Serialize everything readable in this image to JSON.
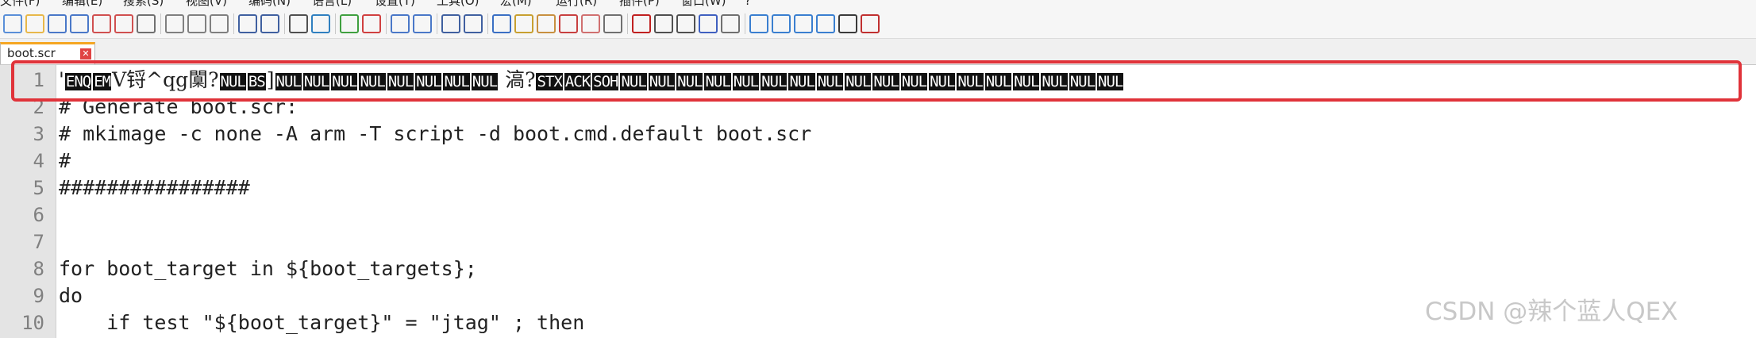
{
  "menu": [
    "文件(F)",
    "编辑(E)",
    "搜索(S)",
    "视图(V)",
    "编码(N)",
    "语言(L)",
    "设置(T)",
    "工具(O)",
    "宏(M)",
    "运行(R)",
    "插件(P)",
    "窗口(W)",
    "?"
  ],
  "toolbar_icons": [
    "new-file-icon",
    "open-file-icon",
    "save-icon",
    "save-all-icon",
    "close-icon",
    "close-all-icon",
    "print-icon",
    "cut-icon",
    "copy-icon",
    "paste-icon",
    "undo-icon",
    "redo-icon",
    "find-icon",
    "replace-icon",
    "zoom-in-icon",
    "zoom-out-icon",
    "sync-vertical-icon",
    "sync-horizontal-icon",
    "word-wrap-icon",
    "show-all-chars-icon",
    "indent-guide-icon",
    "udl-icon",
    "doc-map-icon",
    "function-list-icon",
    "folder-workspace-icon",
    "monitor-icon",
    "record-macro-icon",
    "stop-record-icon",
    "play-macro-icon",
    "run-macro-multiple-icon",
    "save-macro-icon",
    "spell-check-first-icon",
    "spell-check-prev-icon",
    "spell-check-next-icon",
    "spell-check-all-icon",
    "spell-check-icon",
    "abc-spell-icon"
  ],
  "tab": {
    "label": "boot.scr",
    "close": "✕"
  },
  "line1_segments": [
    {
      "t": "'",
      "ctl": false
    },
    {
      "t": "ENQ",
      "ctl": true
    },
    {
      "t": "EM",
      "ctl": true
    },
    {
      "t": "V锊^qg闑?",
      "ctl": false
    },
    {
      "t": "NUL",
      "ctl": true
    },
    {
      "t": "BS",
      "ctl": true
    },
    {
      "t": "]",
      "ctl": false
    },
    {
      "t": "NUL",
      "ctl": true
    },
    {
      "t": "NUL",
      "ctl": true
    },
    {
      "t": "NUL",
      "ctl": true
    },
    {
      "t": "NUL",
      "ctl": true
    },
    {
      "t": "NUL",
      "ctl": true
    },
    {
      "t": "NUL",
      "ctl": true
    },
    {
      "t": "NUL",
      "ctl": true
    },
    {
      "t": "NUL",
      "ctl": true
    },
    {
      "t": " 滈?",
      "ctl": false
    },
    {
      "t": "STX",
      "ctl": true
    },
    {
      "t": "ACK",
      "ctl": true
    },
    {
      "t": "SOH",
      "ctl": true
    },
    {
      "t": "NUL",
      "ctl": true
    },
    {
      "t": "NUL",
      "ctl": true
    },
    {
      "t": "NUL",
      "ctl": true
    },
    {
      "t": "NUL",
      "ctl": true
    },
    {
      "t": "NUL",
      "ctl": true
    },
    {
      "t": "NUL",
      "ctl": true
    },
    {
      "t": "NUL",
      "ctl": true
    },
    {
      "t": "NUL",
      "ctl": true
    },
    {
      "t": "NUL",
      "ctl": true
    },
    {
      "t": "NUL",
      "ctl": true
    },
    {
      "t": "NUL",
      "ctl": true
    },
    {
      "t": "NUL",
      "ctl": true
    },
    {
      "t": "NUL",
      "ctl": true
    },
    {
      "t": "NUL",
      "ctl": true
    },
    {
      "t": "NUL",
      "ctl": true
    },
    {
      "t": "NUL",
      "ctl": true
    },
    {
      "t": "NUL",
      "ctl": true
    },
    {
      "t": "NUL",
      "ctl": true
    }
  ],
  "lines": [
    "# Generate boot.scr:",
    "# mkimage -c none -A arm -T script -d boot.cmd.default boot.scr",
    "#",
    "################",
    "",
    "",
    "for boot_target in ${boot_targets};",
    "do",
    "    if test \"${boot_target}\" = \"jtag\" ; then"
  ],
  "line_numbers": [
    "1",
    "2",
    "3",
    "4",
    "5",
    "6",
    "7",
    "8",
    "9",
    "10"
  ],
  "watermark": "CSDN @辣个蓝人QEX"
}
